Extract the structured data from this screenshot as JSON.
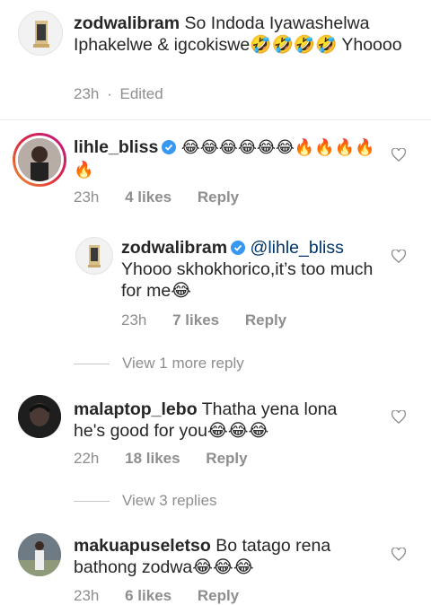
{
  "comments": [
    {
      "username": "zodwalibram",
      "text": "So Indoda Iyawashelwa Iphakelwe & igcokiswe🤣🤣🤣🤣 Yhoooo",
      "time": "23h",
      "edited": "Edited"
    },
    {
      "username": "lihle_bliss",
      "text": "😂😂😂😂😂😂🔥🔥🔥🔥🔥",
      "time": "23h",
      "likes": "4 likes",
      "reply": "Reply",
      "view_more": "View 1 more reply"
    },
    {
      "username": "zodwalibram",
      "mention": "@lihle_bliss",
      "text": "Yhooo skhokhorico,it’s too much for me😂",
      "time": "23h",
      "likes": "7 likes",
      "reply": "Reply"
    },
    {
      "username": "malaptop_lebo",
      "text": "Thatha yena lona he's good for you😂😂😂",
      "time": "22h",
      "likes": "18 likes",
      "reply": "Reply",
      "view_more": "View 3 replies"
    },
    {
      "username": "makuapuseletso",
      "text": "Bo tatago rena bathong zodwa😂😂😂",
      "time": "23h",
      "likes": "6 likes",
      "reply": "Reply"
    }
  ],
  "icons": {
    "heart": "heart-outline-icon",
    "verified": "verified-badge-icon"
  },
  "colors": {
    "verified": "#3897f0",
    "secondary_text": "#8e8e8e",
    "story_ring": "#d6249f"
  }
}
